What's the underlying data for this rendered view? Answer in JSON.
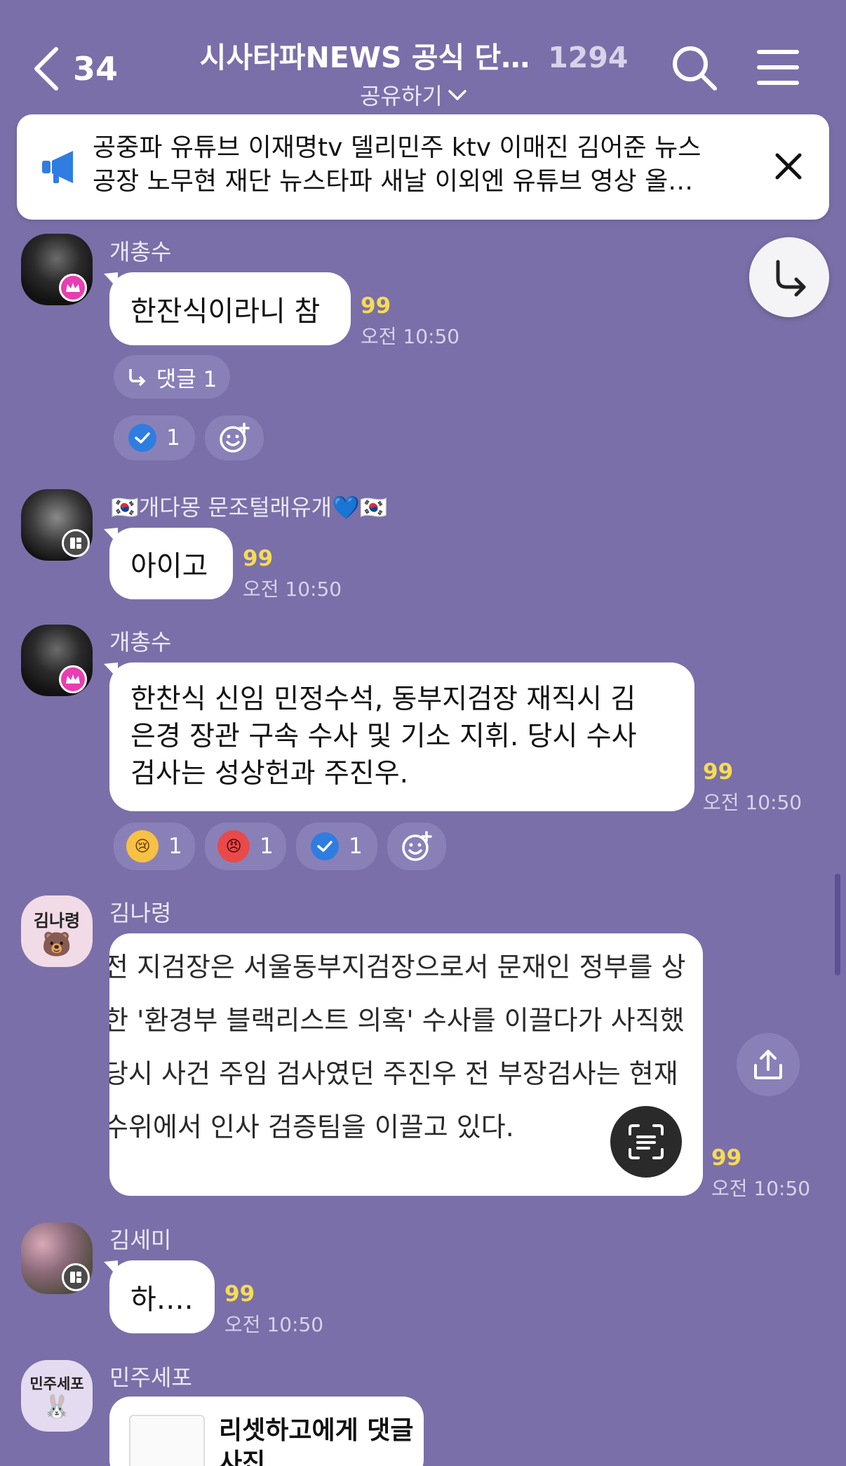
{
  "header": {
    "back_count": "34",
    "room_title": "시사타파NEWS 공식 단…",
    "member_count": "1294",
    "share_label": "공유하기"
  },
  "notice": {
    "line1": "공중파 유튜브 이재명tv 델리민주 ktv 이매진 김어준 뉴스",
    "line2": "공장 노무현 재단 뉴스타파 새날 이외엔 유튜브 영상 올…"
  },
  "messages": [
    {
      "sender": "개총수",
      "text": "한잔식이라니 참",
      "unread": "99",
      "time": "오전 10:50",
      "reply_label": "댓글 1",
      "reactions": [
        {
          "icon": "check-icon",
          "count": "1"
        }
      ]
    },
    {
      "sender": "🇰🇷개다몽 문조털래유개💙🇰🇷",
      "text": "아이고",
      "unread": "99",
      "time": "오전 10:50"
    },
    {
      "sender": "개총수",
      "lines": [
        "한찬식 신임 민정수석, 동부지검장 재직시 김",
        "은경 장관 구속 수사 및 기소 지휘. 당시 수사",
        "검사는 성상헌과 주진우."
      ],
      "unread": "99",
      "time": "오전 10:50",
      "reactions": [
        {
          "icon": "crying-face-icon",
          "count": "1"
        },
        {
          "icon": "angry-face-icon",
          "count": "1"
        },
        {
          "icon": "check-icon",
          "count": "1"
        }
      ]
    },
    {
      "sender": "김나령",
      "avatar_text": "김나령",
      "image_lines": [
        "전 지검장은 서울동부지검장으로서 문재인 정부를 상",
        "한 '환경부 블랙리스트 의혹' 수사를 이끌다가 사직했",
        " 당시 사건 주임 검사였던 주진우 전 부장검사는 현재",
        "수위에서 인사 검증팀을 이끌고 있다."
      ],
      "unread": "99",
      "time": "오전 10:50"
    },
    {
      "sender": "김세미",
      "text": "하….",
      "unread": "99",
      "time": "오전 10:50"
    },
    {
      "sender": "민주세포",
      "avatar_text": "민주세포",
      "card_title": "리셋하고에게 댓글 사진"
    }
  ],
  "colors": {
    "background": "#7a6fa8",
    "unread": "#f7dc52",
    "crown_badge": "#e83eb0"
  }
}
